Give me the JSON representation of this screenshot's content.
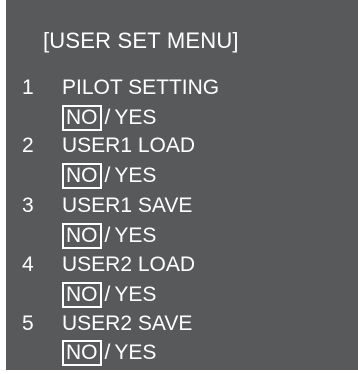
{
  "menu": {
    "title": "[USER SET MENU]",
    "separator": "/",
    "items": [
      {
        "number": "1",
        "label": "PILOT SETTING",
        "selected": "NO",
        "other": "YES"
      },
      {
        "number": "2",
        "label": "USER1 LOAD",
        "selected": "NO",
        "other": "YES"
      },
      {
        "number": "3",
        "label": "USER1 SAVE",
        "selected": "NO",
        "other": "YES"
      },
      {
        "number": "4",
        "label": "USER2 LOAD",
        "selected": "NO",
        "other": "YES"
      },
      {
        "number": "5",
        "label": "USER2 SAVE",
        "selected": "NO",
        "other": "YES"
      }
    ]
  },
  "colors": {
    "screen_background": "#58595b",
    "text": "#ffffff",
    "selection_border": "#ffffff"
  }
}
